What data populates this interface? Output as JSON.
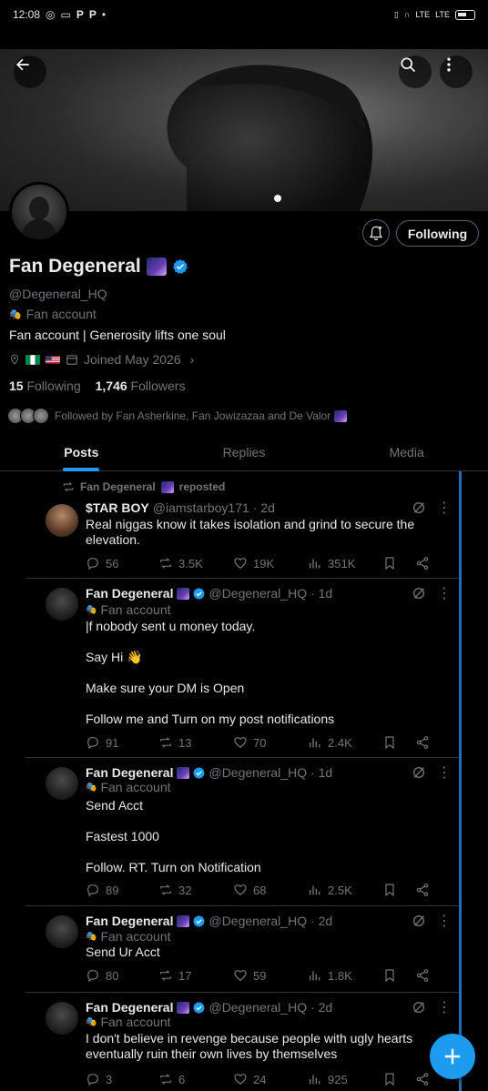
{
  "status_bar": {
    "time": "12:08",
    "network_right": "LTE",
    "signal": "LTE"
  },
  "profile": {
    "name": "Fan Degeneral",
    "handle": "@Degeneral_HQ",
    "fan_label": "Fan account",
    "bio": "Fan account | Generosity lifts one soul",
    "joined": "Joined May 2026",
    "following_count": "15",
    "following_label": "Following",
    "followers_count": "1,746",
    "followers_label": "Followers",
    "followed_by": "Followed by Fan Asherkine, Fan Jowizazaa and De Valor",
    "follow_button": "Following"
  },
  "tabs": [
    {
      "label": "Posts",
      "active": true
    },
    {
      "label": "Replies",
      "active": false
    },
    {
      "label": "Media",
      "active": false
    }
  ],
  "posts": [
    {
      "repost_by": "Fan Degeneral",
      "repost_suffix": "reposted",
      "name": "$TAR BOY",
      "handle": "@iamstarboy171",
      "time": "· 2d",
      "text": "Real niggas know it takes isolation and grind to secure the elevation.",
      "replies": "56",
      "reposts": "3.5K",
      "likes": "19K",
      "views": "351K"
    },
    {
      "name": "Fan Degeneral",
      "handle": "@Degeneral_HQ",
      "time": "· 1d",
      "sub": "Fan account",
      "text": "|f nobody sent u money today.\n\nSay Hi 👋\n\nMake sure your DM is Open\n\nFollow me and Turn on my post notifications",
      "replies": "91",
      "reposts": "13",
      "likes": "70",
      "views": "2.4K"
    },
    {
      "name": "Fan Degeneral",
      "handle": "@Degeneral_HQ",
      "time": "· 1d",
      "sub": "Fan account",
      "text": "Send Acct\n\nFastest 1000\n\nFollow. RT. Turn on Notification",
      "replies": "89",
      "reposts": "32",
      "likes": "68",
      "views": "2.5K"
    },
    {
      "name": "Fan Degeneral",
      "handle": "@Degeneral_HQ",
      "time": "· 2d",
      "sub": "Fan account",
      "text": "Send Ur Acct",
      "replies": "80",
      "reposts": "17",
      "likes": "59",
      "views": "1.8K"
    },
    {
      "name": "Fan Degeneral",
      "handle": "@Degeneral_HQ",
      "time": "· 2d",
      "sub": "Fan account",
      "text": "I don't believe in revenge because people with ugly hearts eventually ruin their own lives by themselves",
      "replies": "3",
      "reposts": "6",
      "likes": "24",
      "views": "925"
    }
  ],
  "colors": {
    "accent": "#1d9bf0",
    "muted": "#71767b",
    "background": "#000000"
  }
}
